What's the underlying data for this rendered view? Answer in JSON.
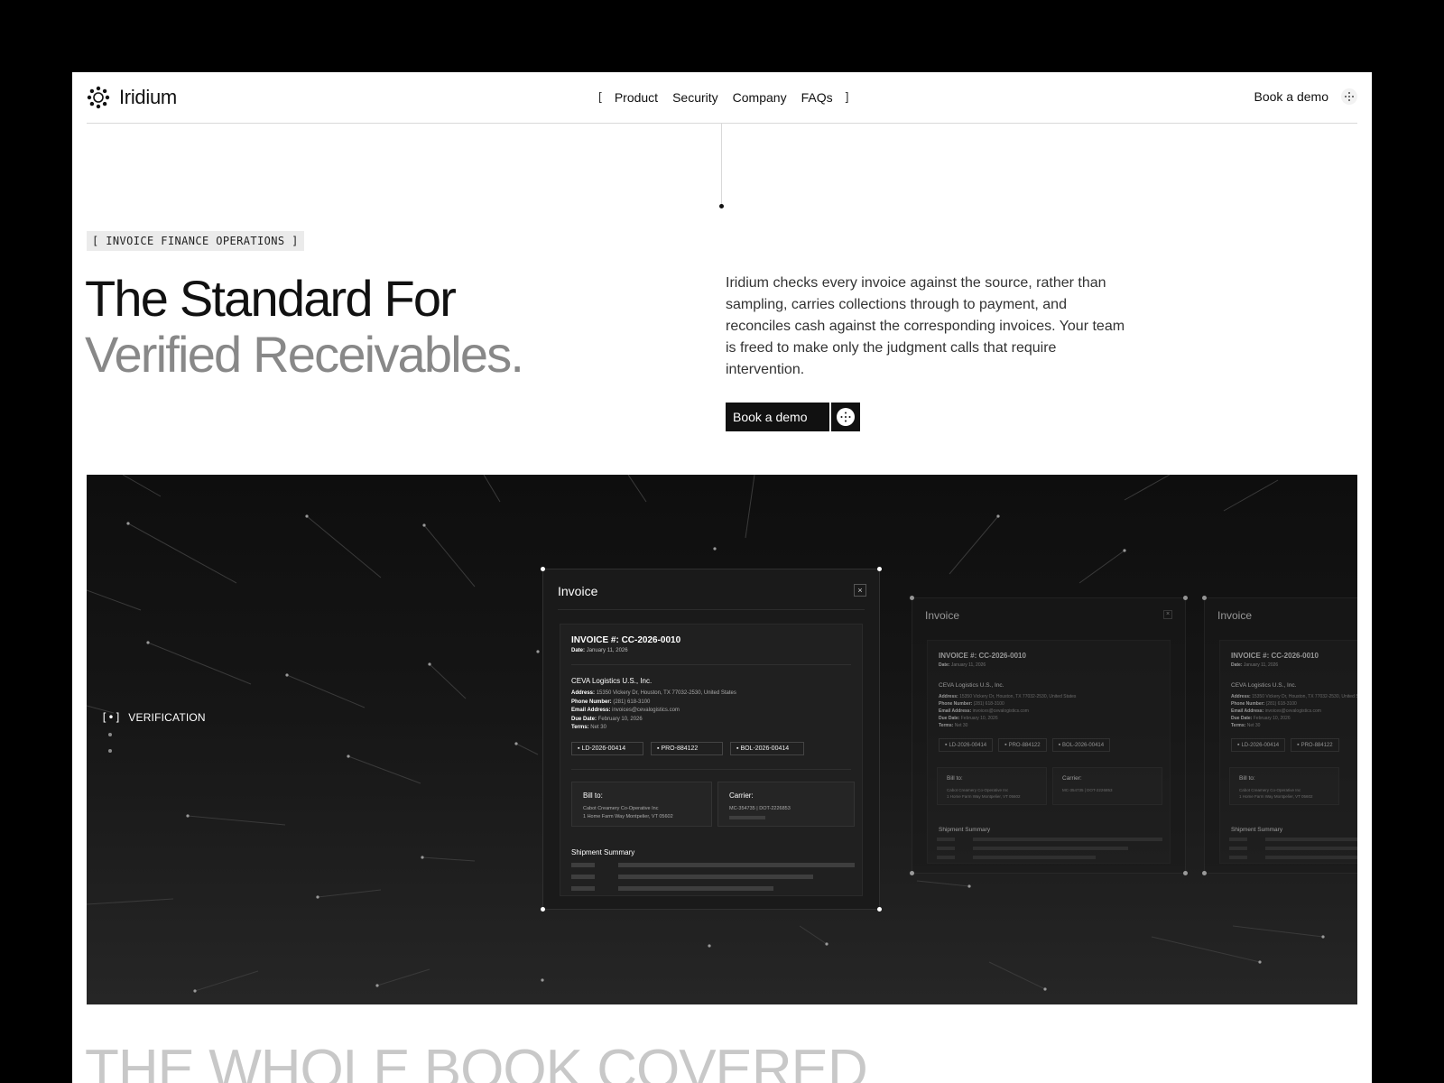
{
  "nav": {
    "brand": "Iridium",
    "menu_open": "[",
    "menu_close": "]",
    "links": [
      "Product",
      "Security",
      "Company",
      "FAQs"
    ],
    "cta": "Book a demo"
  },
  "hero": {
    "eyebrow": "[ INVOICE FINANCE OPERATIONS ]",
    "title_line1": "The Standard For",
    "title_line2": "Verified Receivables.",
    "body": "Iridium checks every invoice against the source, rather than sampling, carries collections through to payment, and reconciles cash against the corresponding invoices. Your team is freed to make only the judgment calls that require intervention.",
    "button": "Book a demo"
  },
  "showcase": {
    "step_bracket": "[•]",
    "step_label": "VERIFICATION",
    "invoice": {
      "window_title": "Invoice",
      "close": "×",
      "number": "INVOICE #: CC-2026-0010",
      "date_label": "Date:",
      "date": "January 11, 2026",
      "company": "CEVA Logistics U.S., Inc.",
      "address_label": "Address:",
      "address": "15350 Vickery Dr, Houston, TX 77032-2530, United States",
      "phone_label": "Phone Number:",
      "phone": "(281) 618-3100",
      "email_label": "Email Address:",
      "email": "invoices@cevalogistics.com",
      "due_label": "Due Date:",
      "due": "February 10, 2026",
      "terms_label": "Terms:",
      "terms": "Net 30",
      "docs": [
        "LD-2026-00414",
        "PRO-884122",
        "BOL-2026-00414"
      ],
      "bill_to_label": "Bill to:",
      "bill_to_line1": "Cabot Creamery Co-Operative Inc",
      "bill_to_line2": "1 Home Farm Way Montpelier, VT 05602",
      "carrier_label": "Carrier:",
      "carrier_line1": "MC-354735 | DOT-2226853",
      "shipment_label": "Shipment Summary"
    }
  },
  "bottom": {
    "heading": "THE WHOLE BOOK COVERED"
  },
  "colors": {
    "accent_dark": "#111111",
    "muted_title": "#888888",
    "showcase_bg": "#161616"
  }
}
